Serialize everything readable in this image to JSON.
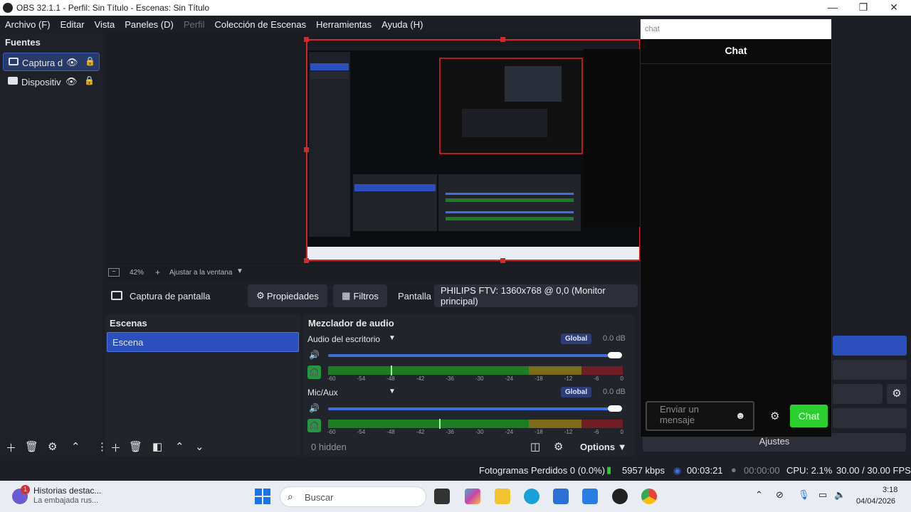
{
  "window": {
    "title": "OBS 32.1.1 - Perfil: Sin Título - Escenas: Sin Título",
    "min_glyph": "—",
    "max_glyph": "❐",
    "close_glyph": "✕"
  },
  "menu": [
    "Archivo (F)",
    "Editar",
    "Vista",
    "Paneles (D)",
    "Perfil",
    "Colección de Escenas",
    "Herramientas",
    "Ayuda (H)"
  ],
  "sources": {
    "header": "Fuentes",
    "items": [
      {
        "label": "Captura d",
        "icon": "monitor-icon",
        "selected": true
      },
      {
        "label": "Dispositiv",
        "icon": "camera-icon",
        "selected": false
      }
    ]
  },
  "zoom": {
    "level": "42%",
    "fit_label": "Ajustar a la ventana"
  },
  "source_bar": {
    "name": "Captura de pantalla",
    "properties": "Propiedades",
    "filters": "Filtros",
    "display_label": "Pantalla",
    "display_value": "PHILIPS FTV: 1360x768 @ 0,0 (Monitor principal)"
  },
  "scenes": {
    "header": "Escenas",
    "items": [
      "Escena"
    ]
  },
  "mixer": {
    "header": "Mezclador de audio",
    "tracks": [
      {
        "name": "Audio del escritorio",
        "badge": "Global",
        "db": "0.0 dB",
        "volume_pct": 100,
        "peak_db": -48
      },
      {
        "name": "Mic/Aux",
        "badge": "Global",
        "db": "0.0 dB",
        "volume_pct": 100,
        "peak_db": -36
      }
    ],
    "ticks": [
      "-60",
      "-54",
      "-48",
      "-42",
      "-36",
      "-30",
      "-24",
      "-18",
      "-12",
      "-6",
      "0"
    ],
    "hidden": "0 hidden",
    "options": "Options"
  },
  "chat": {
    "url": "chat",
    "title": "Chat",
    "placeholder": "Enviar un mensaje",
    "send": "Chat"
  },
  "dock_right": {
    "settings_label": "Ajustes"
  },
  "status": {
    "dropped": "Fotogramas Perdidos 0 (0.0%)",
    "bitrate": "5957 kbps",
    "stream_time": "00:03:21",
    "rec_time": "00:00:00",
    "cpu": "CPU: 2.1%",
    "fps": "30.00 / 30.00 FPS"
  },
  "taskbar": {
    "news_badge": "1",
    "news_title": "Historias destac...",
    "news_sub": "La embajada rus...",
    "search": "Buscar",
    "time": "3:18",
    "date": "04/04/2026"
  },
  "colors": {
    "accent": "#2b4fbd",
    "recording_border": "#d8262b",
    "chat_send": "#2ad12e"
  }
}
